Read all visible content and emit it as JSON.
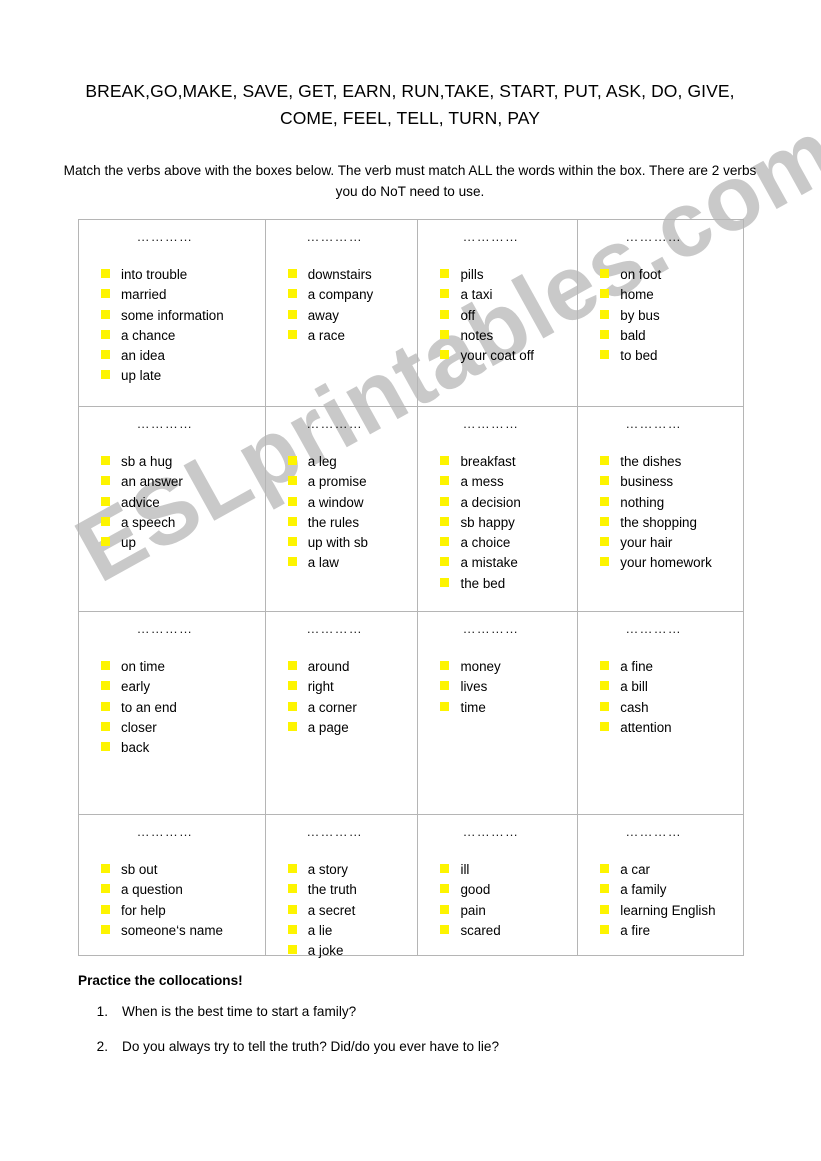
{
  "worksheet": {
    "verb_list": "BREAK,GO,MAKE, SAVE, GET, EARN, RUN,TAKE, START, PUT, ASK, DO, GIVE, COME, FEEL, TELL, TURN, PAY",
    "instructions": "Match the verbs above with the boxes below. The verb must match ALL the words within the box. There are 2 verbs you do NoT need to use.",
    "blank_placeholder": "…………",
    "watermark": "ESLprintables.com",
    "bullet_color": "#fdf400",
    "grid_line_color": "#b5b5b5"
  },
  "boxes": [
    {
      "placeholder": "…………",
      "items": [
        "into trouble",
        "married",
        "some information",
        "a chance",
        "an idea",
        "up late"
      ]
    },
    {
      "placeholder": "…………",
      "items": [
        "downstairs",
        "a company",
        "away",
        "a race"
      ]
    },
    {
      "placeholder": "…………",
      "items": [
        "pills",
        "a taxi",
        "off",
        "notes",
        "your coat off"
      ]
    },
    {
      "placeholder": "…………",
      "items": [
        "on foot",
        "home",
        "by bus",
        "bald",
        "to bed"
      ]
    },
    {
      "placeholder": "…………",
      "items": [
        "sb a hug",
        "an answer",
        "advice",
        "a speech",
        "up"
      ]
    },
    {
      "placeholder": "…………",
      "items": [
        "a leg",
        "a promise",
        "a window",
        "the rules",
        "up with sb",
        "a law"
      ]
    },
    {
      "placeholder": "…………",
      "items": [
        "breakfast",
        "a mess",
        "a decision",
        "sb happy",
        "a choice",
        "a mistake",
        "the bed"
      ]
    },
    {
      "placeholder": "…………",
      "items": [
        "the dishes",
        "business",
        "nothing",
        "the shopping",
        "your hair",
        "your homework"
      ]
    },
    {
      "placeholder": "…………",
      "items": [
        "on time",
        "early",
        "to an end",
        "closer",
        "back"
      ]
    },
    {
      "placeholder": "…………",
      "items": [
        "around",
        "right",
        "a corner",
        "a page"
      ]
    },
    {
      "placeholder": "…………",
      "items": [
        "money",
        "lives",
        "time"
      ]
    },
    {
      "placeholder": "…………",
      "items": [
        "a fine",
        "a bill",
        "cash",
        "attention"
      ]
    },
    {
      "placeholder": "…………",
      "items": [
        "sb out",
        "a question",
        "for help",
        "someone‘s name"
      ]
    },
    {
      "placeholder": "…………",
      "items": [
        "a story",
        "the truth",
        "a secret",
        "a lie",
        "a joke"
      ]
    },
    {
      "placeholder": "…………",
      "items": [
        "ill",
        "good",
        "pain",
        "scared"
      ]
    },
    {
      "placeholder": "…………",
      "items": [
        "a car",
        "a family",
        "learning English",
        "a fire"
      ]
    }
  ],
  "practice": {
    "heading": "Practice the collocations!",
    "questions": [
      {
        "number": "1.",
        "text": "When is the best time to start a family?"
      },
      {
        "number": "2.",
        "text": "Do you always try to tell the truth? Did/do you ever have to lie?"
      }
    ]
  }
}
